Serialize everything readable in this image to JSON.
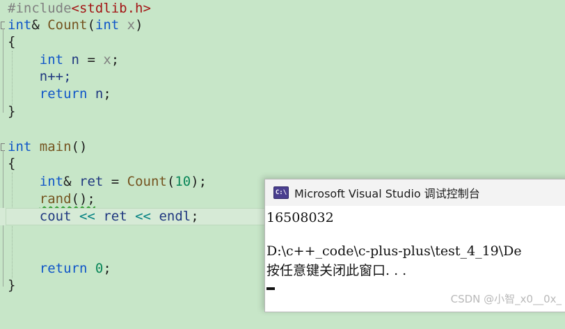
{
  "editor": {
    "include_directive": "#include",
    "include_file": "<stdlib.h>",
    "count_fn": {
      "ret_type": "int",
      "amp": "&",
      "name": "Count",
      "open": "(",
      "param_type": "int",
      "param_name": "x",
      "close": ")"
    },
    "open_brace": "{",
    "close_brace": "}",
    "count_body": {
      "decl_type": "int",
      "decl_var": "n",
      "assign": " = ",
      "assign_src": "x",
      "semi": ";",
      "incr": "n++;",
      "ret_kw": "return",
      "ret_var": "n",
      "ret_semi": ";"
    },
    "main_fn": {
      "ret_type": "int",
      "name": "main",
      "parens": "()"
    },
    "main_body": {
      "ret_type": "int",
      "amp": "&",
      "ret_var": "ret",
      "assign": " = ",
      "call": "Count",
      "call_open": "(",
      "arg": "10",
      "call_close": ");",
      "rand_call": "rand",
      "rand_rest": "();",
      "cout": "cout",
      "shl1": "<<",
      "cout_var": "ret",
      "shl2": "<<",
      "endl": "endl",
      "cout_semi": ";",
      "return_kw": "return",
      "return_val": "0",
      "return_semi": ";"
    }
  },
  "console": {
    "title": "Microsoft Visual Studio 调试控制台",
    "icon_label": "C:\\",
    "output_value": "16508032",
    "exit_path": "D:\\c++_code\\c-plus-plus\\test_4_19\\De",
    "press_key_msg": "按任意键关闭此窗口. . ."
  },
  "watermark": "CSDN @小智_x0__0x_"
}
